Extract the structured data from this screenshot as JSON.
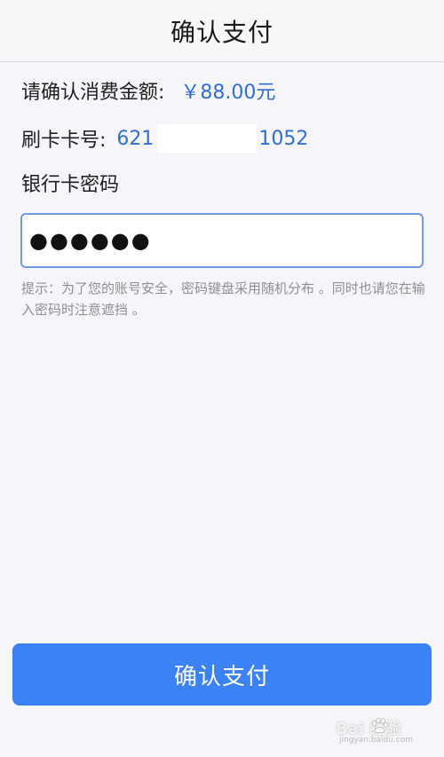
{
  "header": {
    "title": "确认支付"
  },
  "amount": {
    "label": "请确认消费金额:",
    "value": "￥88.00元"
  },
  "card": {
    "label": "刷卡卡号:",
    "prefix": "621",
    "suffix": "1052"
  },
  "password": {
    "label": "银行卡密码",
    "value": "●●●●●●"
  },
  "hint": {
    "text": "提示：为了您的账号安全，密码键盘采用随机分布 。同时也请您在输入密码时注意遮挡 。"
  },
  "confirm_button": {
    "label": "确认支付"
  },
  "watermark": {
    "text": "Bai 经验",
    "sub": "jingyan.baidu.com"
  },
  "colors": {
    "accent": "#3b82f6",
    "value_text": "#2f6fd6",
    "input_border": "#6f9ae8"
  }
}
